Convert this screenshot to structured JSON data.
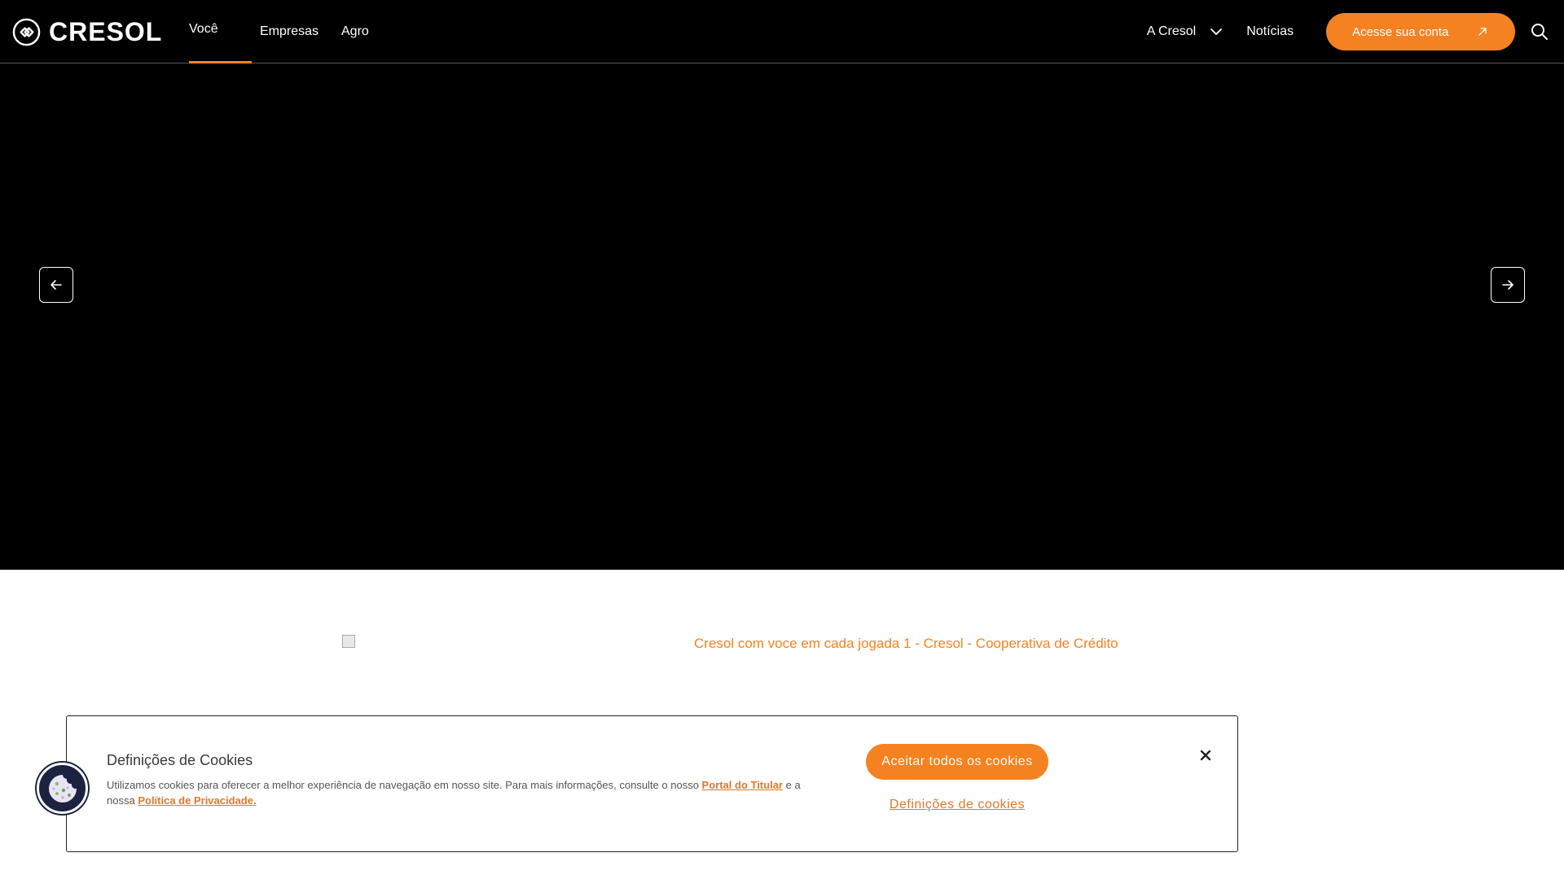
{
  "header": {
    "logo_text": "CRESOL",
    "nav": [
      {
        "label": "Você",
        "active": true
      },
      {
        "label": "Empresas",
        "active": false
      },
      {
        "label": "Agro",
        "active": false
      }
    ],
    "right": {
      "about_label": "A Cresol",
      "news_label": "Notícias",
      "cta_label": "Acesse sua conta"
    },
    "icons": {
      "logo": "cresol-logo-icon",
      "dropdown": "chevron-down-icon",
      "cta": "arrow-up-right-icon",
      "search": "search-icon"
    }
  },
  "hero": {
    "prev_icon": "arrow-left-icon",
    "next_icon": "arrow-right-icon"
  },
  "banner": {
    "alt_text": "Cresol com voce em cada jogada 1 - Cresol - Cooperativa de Crédito"
  },
  "cookie": {
    "title": "Definições de Cookies",
    "text_before": "Utilizamos cookies para oferecer a melhor experiência de navegação em nosso site. Para mais informações, consulte o nosso",
    "link1": "Portal do Titular",
    "text_middle": "e a nossa",
    "link2": "Política de Privacidade.",
    "accept_label": "Aceitar todos os cookies",
    "settings_label": "Definições de cookies",
    "close_icon": "close-icon",
    "fab_icon": "cookie-icon"
  },
  "colors": {
    "accent": "#f58220",
    "header_bg": "#000000",
    "hero_bg": "#000000",
    "fab_bg": "#1c2340"
  }
}
